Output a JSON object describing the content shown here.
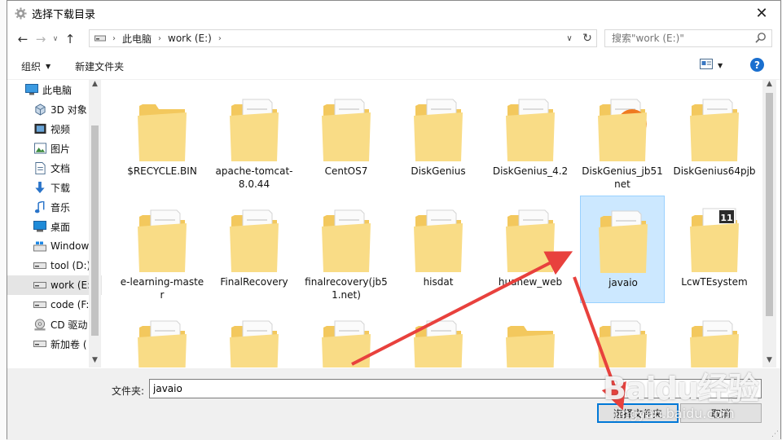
{
  "window": {
    "title": "选择下载目录",
    "close_glyph": "✕"
  },
  "nav": {
    "breadcrumb": [
      "此电脑",
      "work (E:)"
    ],
    "search_placeholder": "搜索\"work (E:)\""
  },
  "toolbar": {
    "organize_label": "组织",
    "new_folder_label": "新建文件夹",
    "help_label": "?"
  },
  "sidebar": {
    "items": [
      {
        "label": "此电脑",
        "icon": "computer-icon",
        "level": "top"
      },
      {
        "label": "3D 对象",
        "icon": "cube-icon",
        "level": "sub"
      },
      {
        "label": "视频",
        "icon": "video-icon",
        "level": "sub"
      },
      {
        "label": "图片",
        "icon": "picture-icon",
        "level": "sub"
      },
      {
        "label": "文档",
        "icon": "document-icon",
        "level": "sub"
      },
      {
        "label": "下载",
        "icon": "download-icon",
        "level": "sub"
      },
      {
        "label": "音乐",
        "icon": "music-icon",
        "level": "sub"
      },
      {
        "label": "桌面",
        "icon": "desktop-icon",
        "level": "sub"
      },
      {
        "label": "Window",
        "icon": "windows-drive-icon",
        "level": "sub"
      },
      {
        "label": "tool (D:)",
        "icon": "drive-icon",
        "level": "sub"
      },
      {
        "label": "work (E:",
        "icon": "drive-icon",
        "level": "sub",
        "selected": true
      },
      {
        "label": "code (F:",
        "icon": "drive-icon",
        "level": "sub"
      },
      {
        "label": "CD 驱动",
        "icon": "cd-drive-icon",
        "level": "sub"
      },
      {
        "label": "新加卷 (",
        "icon": "drive-icon",
        "level": "sub"
      }
    ]
  },
  "files": {
    "rows": [
      [
        {
          "name": "$RECYCLE.BIN",
          "icon": "folder-empty-icon"
        },
        {
          "name": "apache-tomcat-8.0.44",
          "icon": "folder-docs-icon"
        },
        {
          "name": "CentOS7",
          "icon": "folder-docs-icon"
        },
        {
          "name": "DiskGenius",
          "icon": "folder-gear-icon"
        },
        {
          "name": "DiskGenius_4.2",
          "icon": "folder-ie-icon"
        },
        {
          "name": "DiskGenius_jb51net",
          "icon": "folder-ie-orange-icon"
        },
        {
          "name": "DiskGenius64pjb",
          "icon": "folder-docs-icon"
        }
      ],
      [
        {
          "name": "e-learning-master",
          "icon": "folder-docs-icon"
        },
        {
          "name": "FinalRecovery",
          "icon": "folder-app-icon"
        },
        {
          "name": "finalrecovery(jb51.net)",
          "icon": "folder-docs-icon"
        },
        {
          "name": "hisdat",
          "icon": "folder-docs-icon"
        },
        {
          "name": "huanew_web",
          "icon": "folder-docs-icon"
        },
        {
          "name": "javaio",
          "icon": "folder-docs-icon",
          "selected": true
        },
        {
          "name": "LcwTEsystem",
          "icon": "folder-vs-icon"
        }
      ],
      [
        {
          "name": "",
          "icon": "folder-docs-icon"
        },
        {
          "name": "",
          "icon": "folder-docs-icon"
        },
        {
          "name": "",
          "icon": "folder-docs-icon"
        },
        {
          "name": "",
          "icon": "folder-docs-icon"
        },
        {
          "name": "",
          "icon": "folder-empty-icon"
        },
        {
          "name": "",
          "icon": "folder-docs-icon"
        },
        {
          "name": "",
          "icon": "folder-docs-icon"
        }
      ]
    ]
  },
  "footer": {
    "folder_label": "文件夹:",
    "folder_value": "javaio",
    "select_button": "选择文件夹",
    "cancel_button": "取消"
  },
  "watermark": {
    "brand": "Baidu经验",
    "url": "jingyan.baidu.com"
  },
  "colors": {
    "accent": "#0078d7",
    "selection": "#cce8ff",
    "folder": "#f7d57a",
    "arrow": "#e8413d"
  }
}
